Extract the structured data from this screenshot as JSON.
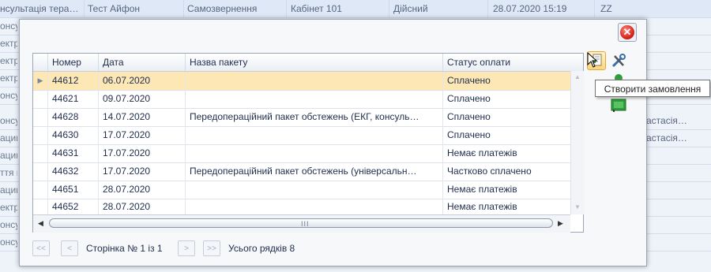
{
  "background": {
    "top_row": [
      "нсультація тера…",
      "Тест Айфон",
      "Самозвернення",
      "Кабінет 101",
      "Дійсний",
      "28.07.2020 15:19",
      "ZZ"
    ],
    "left_fragments": [
      "онсу",
      "ектр",
      "ектр",
      "ектр",
      "онсу",
      "онсу",
      "ацин",
      "ацин",
      "ття м",
      "ацин",
      "ектр",
      "онсу",
      "онсу"
    ],
    "right_fragments": [
      "астасія…",
      "астасія…"
    ]
  },
  "dialog": {
    "close_label": "✕",
    "grid": {
      "columns": [
        "Номер",
        "Дата",
        "Назва пакету",
        "Статус оплати"
      ],
      "rows": [
        {
          "number": "44612",
          "date": "06.07.2020",
          "package": "",
          "status": "Сплачено",
          "selected": true
        },
        {
          "number": "44621",
          "date": "09.07.2020",
          "package": "",
          "status": "Сплачено"
        },
        {
          "number": "44628",
          "date": "14.07.2020",
          "package": "Передопераційний пакет обстежень (ЕКГ, консуль…",
          "status": "Сплачено"
        },
        {
          "number": "44630",
          "date": "17.07.2020",
          "package": "",
          "status": "Сплачено"
        },
        {
          "number": "44631",
          "date": "17.07.2020",
          "package": "",
          "status": "Немає платежів"
        },
        {
          "number": "44632",
          "date": "17.07.2020",
          "package": "Передопераційний пакет обстежень (універсальн…",
          "status": "Частково сплачено"
        },
        {
          "number": "44651",
          "date": "28.07.2020",
          "package": "",
          "status": "Немає платежів"
        },
        {
          "number": "44652",
          "date": "28.07.2020",
          "package": "",
          "status": "Немає платежів"
        }
      ],
      "hscroll_grip": "III"
    },
    "tooltip": "Створити замовлення",
    "pager": {
      "first": "<<",
      "prev": "<",
      "next": ">",
      "last": ">>",
      "page_label": "Сторінка № 1 із 1",
      "rows_label": "Усього рядків 8"
    },
    "icons": {
      "create": "create-order-icon",
      "settings": "tools-icon",
      "green": "green-action-icon",
      "flag": "green-flag-icon"
    }
  }
}
